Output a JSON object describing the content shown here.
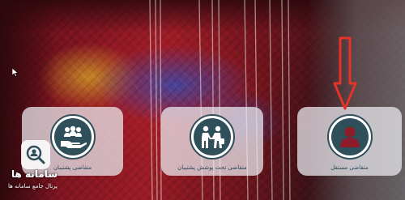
{
  "cards": [
    {
      "label": "متقاضی پشتیبان",
      "icon": "group-hand-icon"
    },
    {
      "label": "متقاضی تحت پوشش پشتیبان",
      "icon": "handshake-icon"
    },
    {
      "label": "متقاضی مستقل",
      "icon": "user-icon"
    }
  ],
  "watermark": {
    "title": "سامانه ها",
    "subtitle": "پرتال جامع سامانه ها"
  },
  "colors": {
    "card_bg": "#ebebf0",
    "icon_dark": "#2f4f5a",
    "accent_red": "#e6332a",
    "user_maroon": "#8e1c2a",
    "label_text": "#2b4a5a"
  }
}
